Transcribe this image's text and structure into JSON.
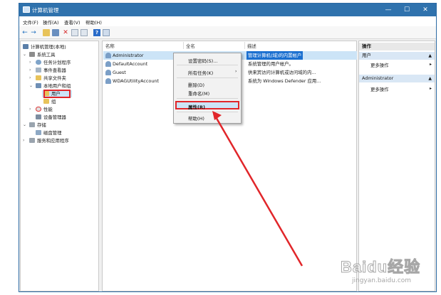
{
  "window": {
    "title": "计算机管理",
    "min": "—",
    "max": "☐",
    "close": "✕"
  },
  "menu": [
    {
      "label": "文件(F)"
    },
    {
      "label": "操作(A)"
    },
    {
      "label": "查看(V)"
    },
    {
      "label": "帮助(H)"
    }
  ],
  "toolbar": {
    "back": "←",
    "forward": "→"
  },
  "tree": {
    "root": "计算机管理(本地)",
    "system_tools": "系统工具",
    "task_scheduler": "任务计划程序",
    "event_viewer": "事件查看器",
    "shared_folders": "共享文件夹",
    "local_users": "本地用户和组",
    "users": "用户",
    "groups": "组",
    "performance": "性能",
    "device_manager": "设备管理器",
    "storage": "存储",
    "disk_mgmt": "磁盘管理",
    "services_apps": "服务和应用程序"
  },
  "list": {
    "columns": {
      "name": "名称",
      "fullname": "全名",
      "desc": "描述"
    },
    "rows": [
      {
        "name": "Administrator",
        "desc": "管理计算机(域)的内置帐户"
      },
      {
        "name": "DefaultAccount",
        "desc": "系统管理的用户帐户。"
      },
      {
        "name": "Guest",
        "desc": "供来宾访问计算机或访问域的内..."
      },
      {
        "name": "WDAGUtilityAccount",
        "desc": "系统为 Windows Defender 应用..."
      }
    ]
  },
  "actions": {
    "title": "操作",
    "sec1": "用户",
    "sec1_more": "更多操作",
    "sec2": "Administrator",
    "sec2_more": "更多操作",
    "arrow": "▸",
    "collapse": "▲"
  },
  "context_menu": {
    "set_password": "设置密码(S)...",
    "all_tasks": "所有任务(K)",
    "submenu_arrow": "›",
    "delete": "删除(D)",
    "rename": "重命名(M)",
    "properties": "属性(R)",
    "help": "帮助(H)"
  },
  "watermark": {
    "brand": "Baidu经验",
    "site": "jingyan.baidu.com"
  },
  "colors": {
    "titlebar": "#2f72ad",
    "highlight": "#e1262a",
    "selection": "#cce4f7"
  }
}
